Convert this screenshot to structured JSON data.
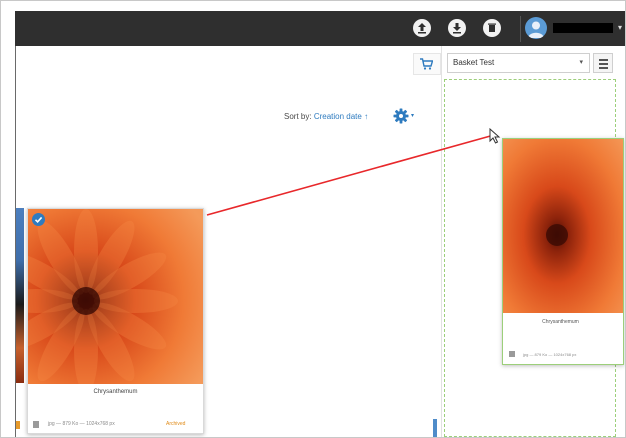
{
  "topbar": {
    "icons": [
      "upload-icon",
      "download-icon",
      "delete-icon"
    ],
    "user_name": "username"
  },
  "basket": {
    "cart_icon": "cart-icon",
    "selected": "Basket Test",
    "menu_icon": "hamburger-icon"
  },
  "sort": {
    "label": "Sort by:",
    "value": "Creation date",
    "direction_icon": "sort-desc-icon",
    "gear_icon": "gear-icon"
  },
  "cards": [
    {
      "title": "Chrysanthemum",
      "meta": "jpg — 879 Ko — 1024x768 px",
      "status": "Archived",
      "selected": true,
      "status_color": "#e08a16"
    }
  ],
  "drag_preview": {
    "title": "Chrysanthemum",
    "meta": "jpg — 879 Ko — 1024x768 px"
  },
  "colors": {
    "accent": "#2e7bbf",
    "drop_zone": "#9ccf7a",
    "drag_line": "#e8282b",
    "topbar": "#2f2f2f"
  }
}
